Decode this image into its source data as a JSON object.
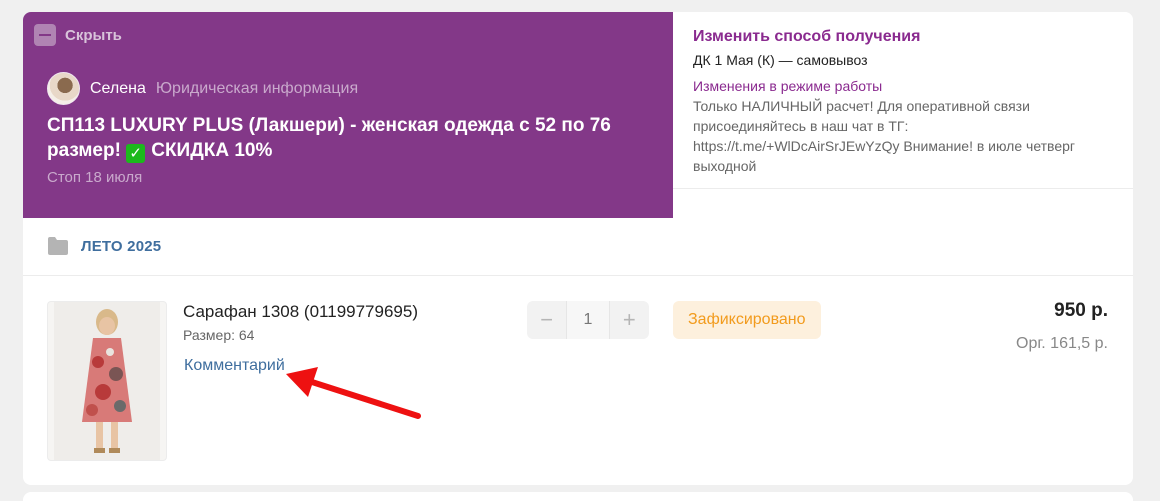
{
  "header": {
    "hide_label": "Скрыть",
    "organizer_name": "Селена",
    "legal_info_link": "Юридическая информация",
    "title_text": "СП113 LUXURY PLUS (Лакшери) - женская одежда с 52 по 76 размер!",
    "title_check": "✓",
    "title_discount": "СКИДКА 10%",
    "stop_date": "Стоп 18 июля",
    "background_color": "#833888"
  },
  "delivery": {
    "change_link": "Изменить способ получения",
    "pickup_point": "ДК 1 Мая (К) — самовывоз",
    "notice_title": "Изменения в режиме работы",
    "notice_text": "Только НАЛИЧНЫЙ расчет! Для оперативной связи присоединяйтесь в наш чат в ТГ: https://t.me/+WlDcAirSrJEwYzQy Внимание! в июле четверг выходной"
  },
  "section": {
    "icon": "folder-icon",
    "label": "ЛЕТО 2025"
  },
  "item": {
    "name": "Сарафан 1308 (01199779695)",
    "size": "Размер: 64",
    "comment_link": "Комментарий",
    "quantity": {
      "minus": "−",
      "value": "1",
      "plus": "+"
    },
    "status": "Зафиксировано",
    "price": "950 р.",
    "org_fee": "Орг. 161,5 р."
  },
  "annotation": {
    "arrow_color": "#ee1111",
    "points_to": "comment-link"
  }
}
